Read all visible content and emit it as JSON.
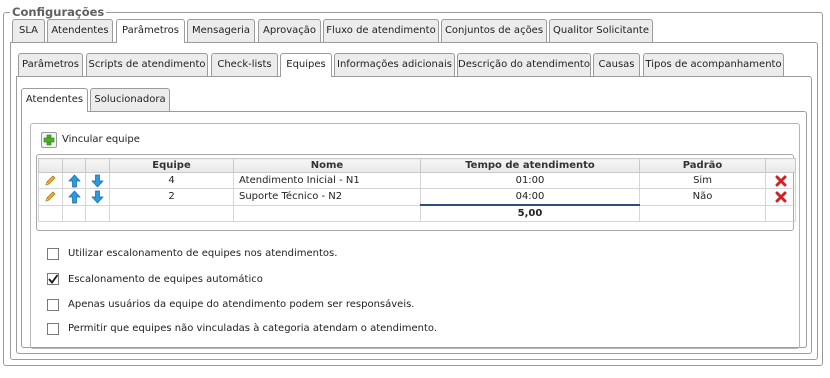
{
  "fieldset_title": "Configurações",
  "tabs_level1": [
    {
      "label": "SLA",
      "active": false
    },
    {
      "label": "Atendentes",
      "active": false
    },
    {
      "label": "Parâmetros",
      "active": true
    },
    {
      "label": "Mensageria",
      "active": false
    },
    {
      "label": "Aprovação",
      "active": false
    },
    {
      "label": "Fluxo de atendimento",
      "active": false
    },
    {
      "label": "Conjuntos de ações",
      "active": false
    },
    {
      "label": "Qualitor Solicitante",
      "active": false
    }
  ],
  "tabs_level2": [
    {
      "label": "Parâmetros",
      "active": false
    },
    {
      "label": "Scripts de atendimento",
      "active": false
    },
    {
      "label": "Check-lists",
      "active": false
    },
    {
      "label": "Equipes",
      "active": true
    },
    {
      "label": "Informações adicionais",
      "active": false
    },
    {
      "label": "Descrição do atendimento",
      "active": false
    },
    {
      "label": "Causas",
      "active": false
    },
    {
      "label": "Tipos de acompanhamento",
      "active": false
    }
  ],
  "tabs_level3": [
    {
      "label": "Atendentes",
      "active": true
    },
    {
      "label": "Solucionadora",
      "active": false
    }
  ],
  "link_team_label": "Vincular equipe",
  "table": {
    "columns": [
      "Equipe",
      "Nome",
      "Tempo de atendimento",
      "Padrão"
    ],
    "rows": [
      {
        "equipe": "4",
        "nome": "Atendimento Inicial - N1",
        "tempo": "01:00",
        "padrao": "Sim"
      },
      {
        "equipe": "2",
        "nome": "Suporte Técnico - N2",
        "tempo": "04:00",
        "padrao": "Não"
      }
    ],
    "total": "5,00"
  },
  "options": [
    {
      "label": "Utilizar escalonamento de equipes nos atendimentos.",
      "checked": false
    },
    {
      "label": "Escalonamento de equipes automático",
      "checked": true
    },
    {
      "label": "Apenas usuários da equipe do atendimento podem ser responsáveis.",
      "checked": false
    },
    {
      "label": "Permitir que equipes não vinculadas à categoria atendam o atendimento.",
      "checked": false
    }
  ],
  "colors": {
    "accent": "#1f4e8c",
    "add_green": "#4caf2a",
    "delete_red": "#d42020",
    "arrow_blue": "#1e90d6",
    "pencil": "#e0a020"
  }
}
